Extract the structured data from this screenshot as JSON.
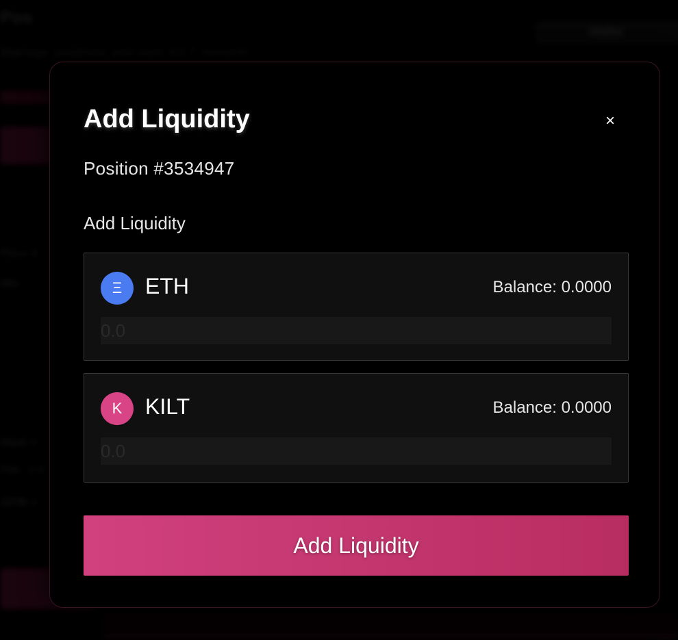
{
  "background": {
    "title": "Pos",
    "subtitle": "Manage positions and earn KILT rewards",
    "topright_text": "Wallet",
    "rows": [
      "Price A",
      "Min",
      "Max",
      "Fee",
      "APR",
      "0.0",
      "0.0",
      "0.0"
    ]
  },
  "modal": {
    "title": "Add Liquidity",
    "close_symbol": "×",
    "position_label": "Position #3534947",
    "section_label": "Add Liquidity",
    "tokens": [
      {
        "symbol": "ETH",
        "icon_letter": "Ξ",
        "icon_name": "eth-icon",
        "balance": "Balance: 0.0000",
        "placeholder": "0.0",
        "color": "#4a7bf0"
      },
      {
        "symbol": "KILT",
        "icon_letter": "K",
        "icon_name": "kilt-icon",
        "balance": "Balance: 0.0000",
        "placeholder": "0.0",
        "color": "#d94486"
      }
    ],
    "submit_label": "Add Liquidity"
  },
  "colors": {
    "accent_start": "#d0417e",
    "accent_end": "#b82d61",
    "modal_border": "#3a1425"
  }
}
